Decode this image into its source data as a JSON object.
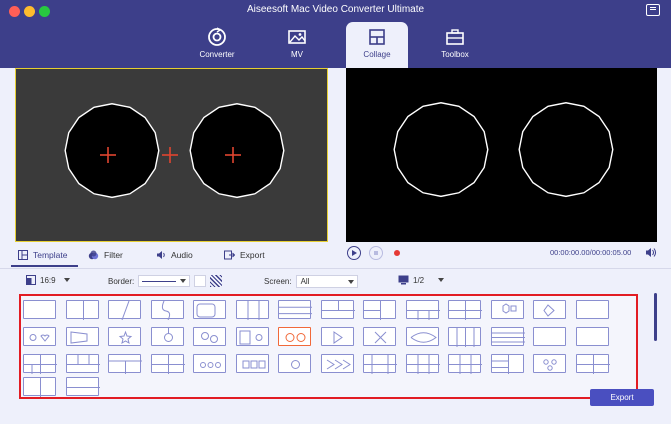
{
  "app": {
    "title": "Aiseesoft Mac Video Converter Ultimate"
  },
  "nav": {
    "tabs": [
      {
        "label": "Converter",
        "icon": "converter-icon"
      },
      {
        "label": "MV",
        "icon": "mv-icon"
      },
      {
        "label": "Collage",
        "icon": "collage-icon",
        "active": true
      },
      {
        "label": "Toolbox",
        "icon": "toolbox-icon"
      }
    ]
  },
  "panel_tabs": [
    {
      "label": "Template",
      "icon": "template-icon",
      "active": true
    },
    {
      "label": "Filter",
      "icon": "filter-icon"
    },
    {
      "label": "Audio",
      "icon": "audio-icon"
    },
    {
      "label": "Export",
      "icon": "export-icon"
    }
  ],
  "player": {
    "timecode": "00:00:00.00/00:00:05.00"
  },
  "options": {
    "aspect_ratio": "16:9",
    "border_label": "Border:",
    "screen_label": "Screen:",
    "screen_value": "All",
    "page": "1/2"
  },
  "colors": {
    "accent": "#3d3f8a",
    "highlight_box": "#e21c23",
    "selected_template": "#f1693a",
    "preview_border": "#e6cf32",
    "plus_sign": "#e0452f"
  },
  "templates": {
    "rows": 4,
    "per_row": 14,
    "selected_index": 20
  },
  "export_button": {
    "label": "Export"
  }
}
